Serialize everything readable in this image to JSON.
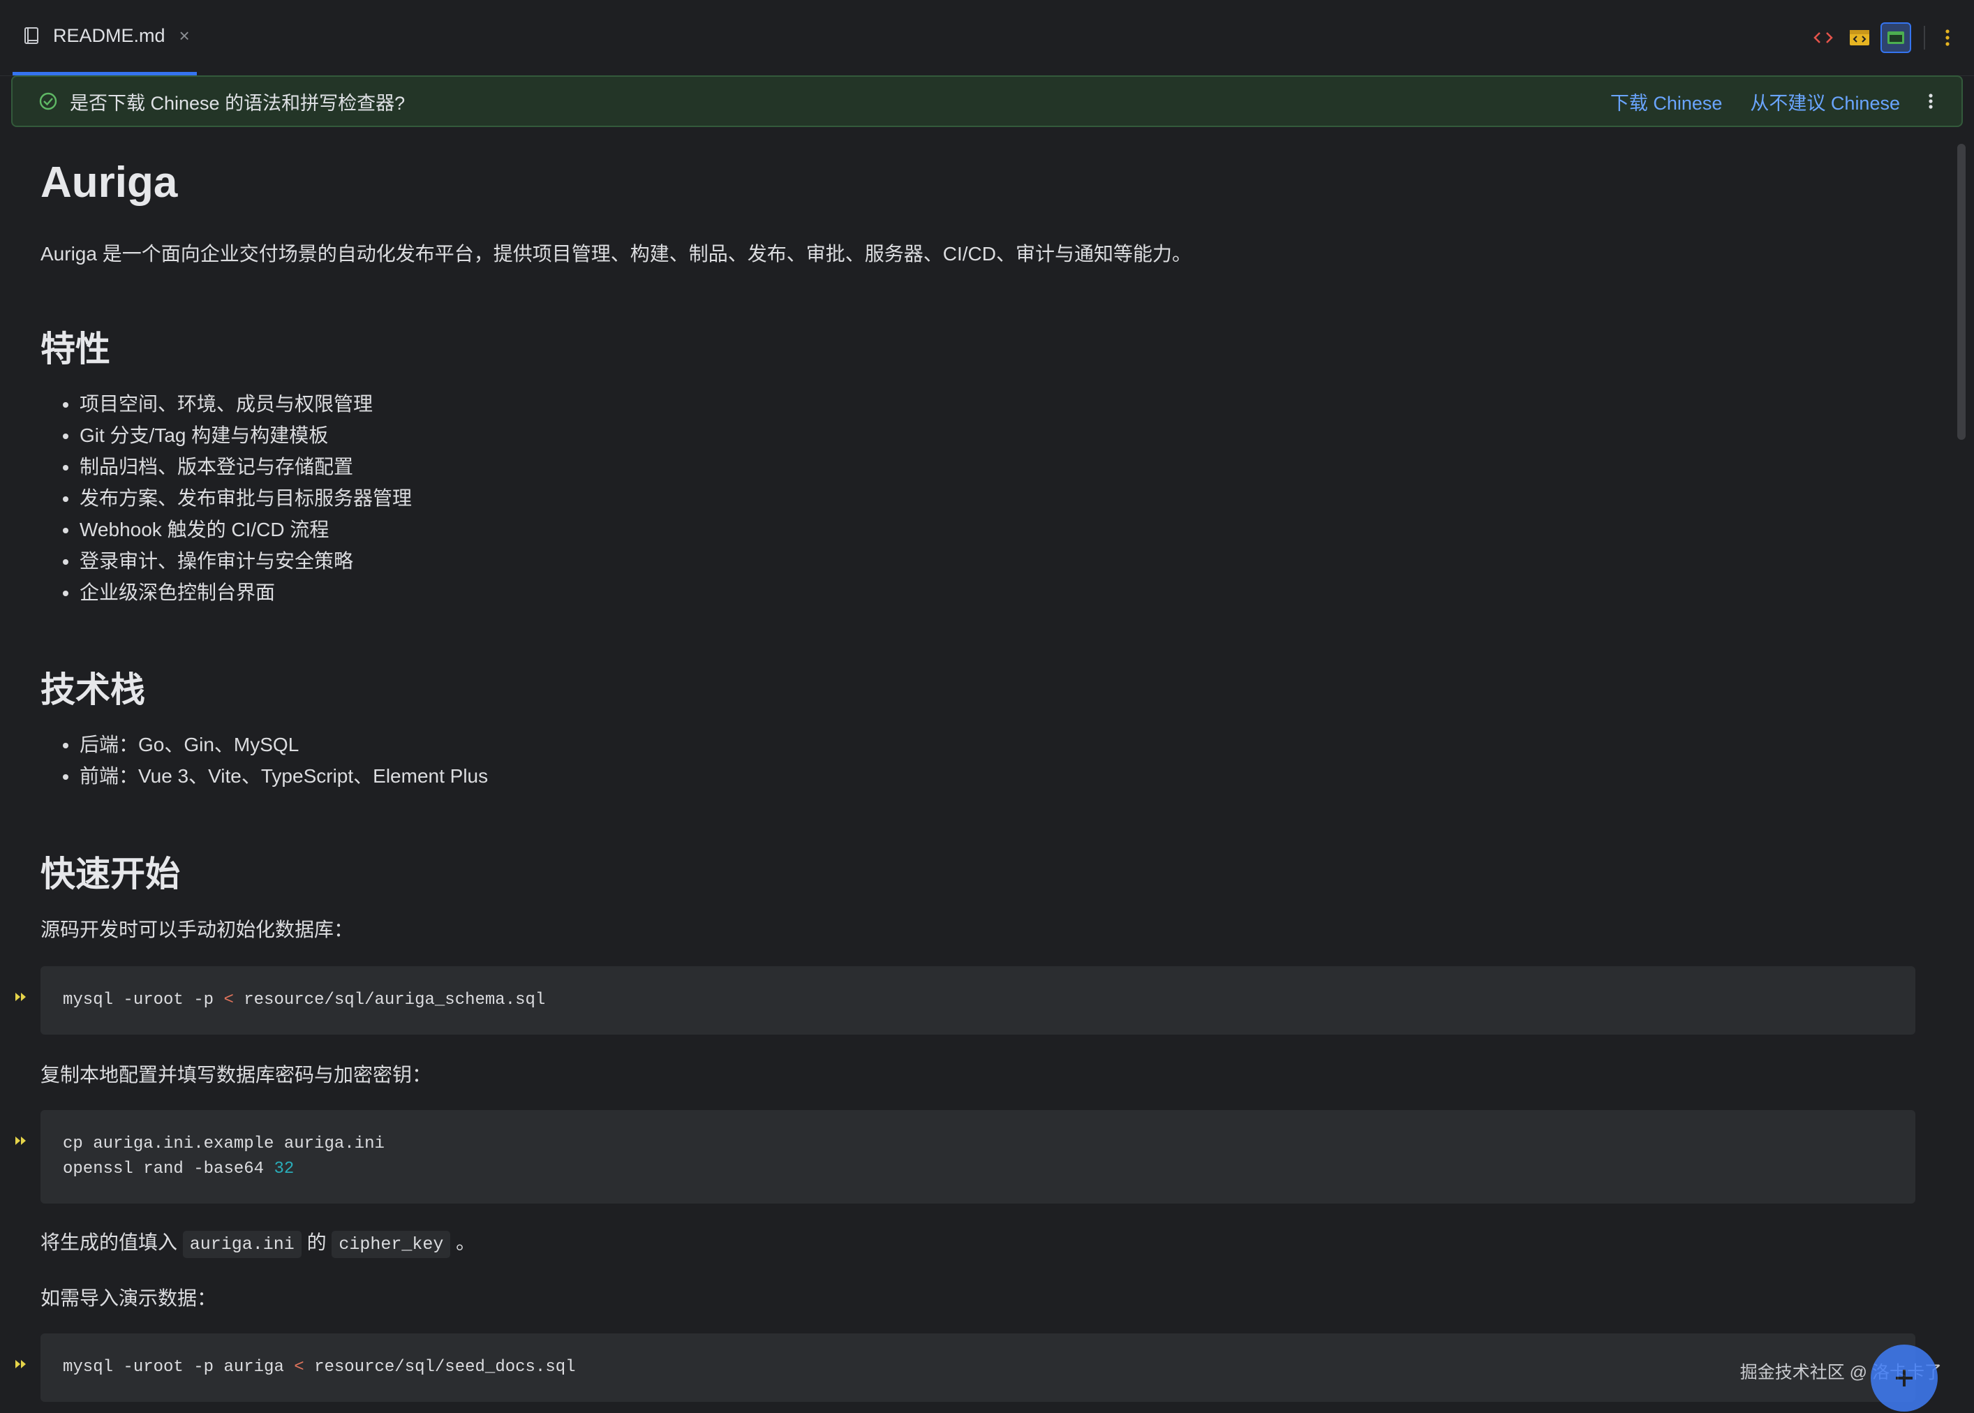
{
  "tab": {
    "file_name": "README.md",
    "close_glyph": "×"
  },
  "toolbar": {
    "icons": [
      "code-view-icon",
      "split-preview-icon",
      "preview-only-icon",
      "more-vert-icon"
    ]
  },
  "banner": {
    "message": "是否下载 Chinese 的语法和拼写检查器?",
    "download_label": "下载 Chinese",
    "never_label": "从不建议 Chinese"
  },
  "doc": {
    "title": "Auriga",
    "intro": "Auriga 是一个面向企业交付场景的自动化发布平台，提供项目管理、构建、制品、发布、审批、服务器、CI/CD、审计与通知等能力。",
    "features_heading": "特性",
    "features": [
      "项目空间、环境、成员与权限管理",
      "Git 分支/Tag 构建与构建模板",
      "制品归档、版本登记与存储配置",
      "发布方案、发布审批与目标服务器管理",
      "Webhook 触发的 CI/CD 流程",
      "登录审计、操作审计与安全策略",
      "企业级深色控制台界面"
    ],
    "stack_heading": "技术栈",
    "stack": [
      "后端：Go、Gin、MySQL",
      "前端：Vue 3、Vite、TypeScript、Element Plus"
    ],
    "quickstart_heading": "快速开始",
    "qs_p1": "源码开发时可以手动初始化数据库：",
    "code1": {
      "a": "mysql -uroot -p ",
      "op": "<",
      "b": " resource/sql/auriga_schema.sql"
    },
    "qs_p2": "复制本地配置并填写数据库密码与加密密钥：",
    "code2": {
      "line1": "cp auriga.ini.example auriga.ini",
      "line2a": "openssl rand -base64 ",
      "line2num": "32"
    },
    "qs_p3": {
      "pre": "将生成的值填入 ",
      "code_a": "auriga.ini",
      "mid": " 的 ",
      "code_b": "cipher_key",
      "post": " 。"
    },
    "qs_p4": "如需导入演示数据：",
    "code3": {
      "a": "mysql -uroot -p auriga ",
      "op": "<",
      "b": " resource/sql/seed_docs.sql"
    }
  },
  "watermark": "掘金技术社区 @ 洛卡卡了",
  "colors": {
    "accent": "#3574f0",
    "link": "#6aa5ff",
    "banner_bg": "#233527",
    "code_bg": "#2b2d30"
  }
}
